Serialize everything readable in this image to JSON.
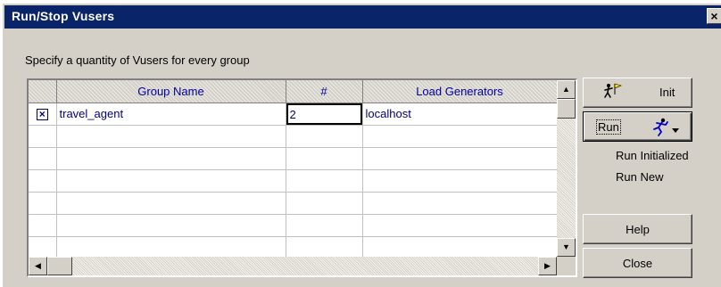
{
  "window": {
    "title": "Run/Stop Vusers",
    "close_glyph": "×"
  },
  "instruction": "Specify a quantity of Vusers for every group",
  "grid": {
    "columns": [
      "Group Name",
      "#",
      "Load Generators"
    ],
    "rows": [
      {
        "enabled": true,
        "check_glyph": "×",
        "group_name": "travel_agent",
        "count": "2",
        "load_generator": "localhost"
      }
    ],
    "empty_row_count": 6
  },
  "buttons": {
    "init": {
      "label": "Init",
      "icon": "runner-flag-icon"
    },
    "run": {
      "label": "Run",
      "icon": "running-man-icon"
    },
    "help": {
      "label": "Help"
    },
    "close": {
      "label": "Close"
    }
  },
  "run_menu": [
    "Run Initialized",
    "Run New"
  ],
  "colors": {
    "title_bar": "#0a246a",
    "dialog": "#d4d0c8",
    "grid_text": "#000080"
  }
}
